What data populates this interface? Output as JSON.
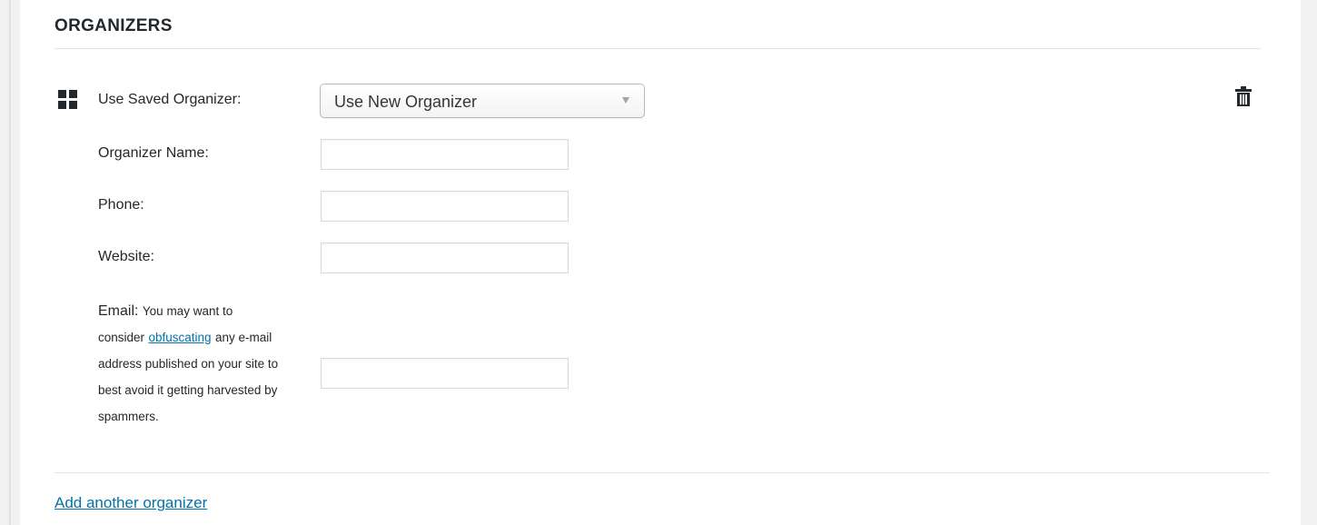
{
  "section": {
    "title": "ORGANIZERS"
  },
  "organizer": {
    "saved_label": "Use Saved Organizer:",
    "saved_select_value": "Use New Organizer",
    "name_label": "Organizer Name:",
    "name_value": "",
    "phone_label": "Phone:",
    "phone_value": "",
    "website_label": "Website:",
    "website_value": "",
    "email_label": "Email:",
    "email_note_before": "You may want to consider",
    "email_note_link": "obfuscating",
    "email_note_after": "any e-mail address published on your site to best avoid it getting harvested by spammers.",
    "email_value": ""
  },
  "actions": {
    "add_another_label": "Add another organizer"
  },
  "icons": {
    "drag": "drag-handle-icon",
    "delete": "trash-icon",
    "dropdown": "chevron-down-icon"
  },
  "colors": {
    "link": "#0073aa",
    "text": "#23282d",
    "background": "#f1f1f1",
    "panel": "#ffffff"
  }
}
